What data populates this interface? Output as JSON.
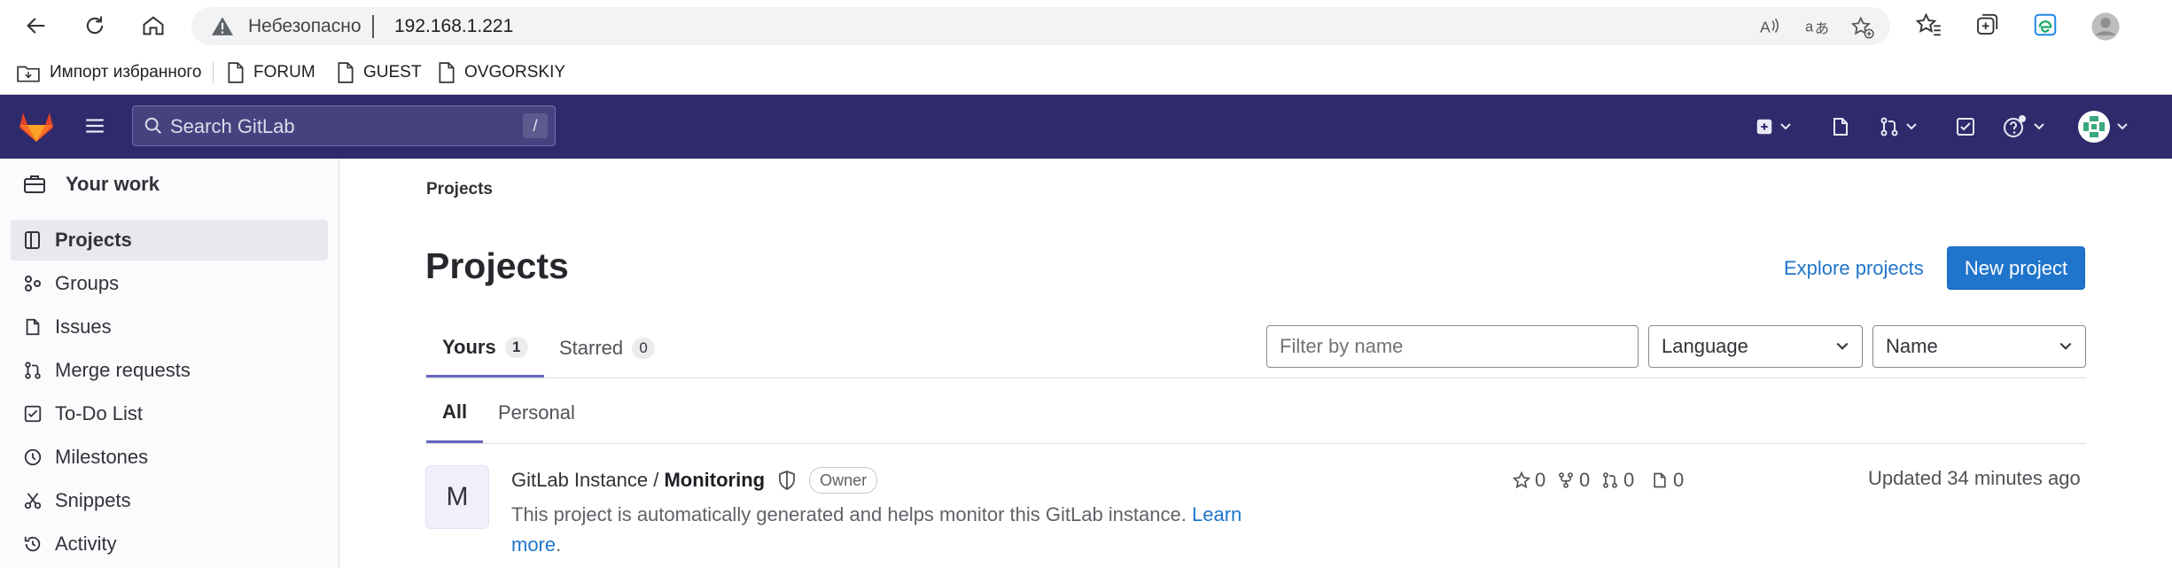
{
  "browser": {
    "insecure_label": "Небезопасно",
    "url": "192.168.1.221",
    "bookmarks": [
      "Импорт избранного",
      "FORUM",
      "GUEST",
      "OVGORSKIY"
    ]
  },
  "gitlab": {
    "search_placeholder": "Search GitLab",
    "search_shortcut": "/"
  },
  "sidebar": {
    "context": "Your work",
    "items": [
      {
        "label": "Projects",
        "icon": "project-icon",
        "active": true
      },
      {
        "label": "Groups",
        "icon": "group-icon"
      },
      {
        "label": "Issues",
        "icon": "issues-icon"
      },
      {
        "label": "Merge requests",
        "icon": "merge-request-icon"
      },
      {
        "label": "To-Do List",
        "icon": "todo-icon"
      },
      {
        "label": "Milestones",
        "icon": "milestone-icon"
      },
      {
        "label": "Snippets",
        "icon": "snippet-icon"
      },
      {
        "label": "Activity",
        "icon": "activity-icon"
      }
    ]
  },
  "main": {
    "breadcrumb": "Projects",
    "title": "Projects",
    "explore_label": "Explore projects",
    "new_project_label": "New project",
    "tabs": [
      {
        "label": "Yours",
        "count": "1"
      },
      {
        "label": "Starred",
        "count": "0"
      }
    ],
    "filter_placeholder": "Filter by name",
    "language_select": "Language",
    "sort_select": "Name",
    "subtabs": [
      "All",
      "Personal"
    ],
    "project": {
      "avatar_letter": "M",
      "namespace": "GitLab Instance / ",
      "name": "Monitoring",
      "role": "Owner",
      "description": "This project is automatically generated and helps monitor this GitLab instance.",
      "learn_more": "Learn more",
      "stars": "0",
      "forks": "0",
      "merge_requests": "0",
      "issues": "0",
      "updated": "Updated 34 minutes ago"
    }
  }
}
